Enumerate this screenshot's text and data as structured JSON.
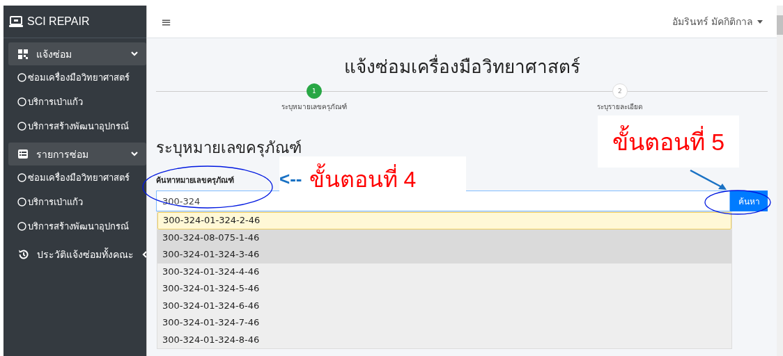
{
  "sidebar": {
    "brand": "SCI REPAIR",
    "groups": [
      {
        "label": "แจ้งซ่อม",
        "expanded": true,
        "items": [
          "ซ่อมเครื่องมือวิทยาศาสตร์",
          "บริการเป่าแก้ว",
          "บริการสร้างพัฒนาอุปกรณ์"
        ]
      },
      {
        "label": "รายการซ่อม",
        "expanded": true,
        "items": [
          "ซ่อมเครื่องมือวิทยาศาสตร์",
          "บริการเป่าแก้ว",
          "บริการสร้างพัฒนาอุปกรณ์"
        ]
      },
      {
        "label": "ประวัติแจ้งซ่อมทั้งคณะ",
        "expanded": false
      }
    ]
  },
  "header": {
    "menu_icon": "≡",
    "user": "อัมรินทร์ มัคกิติกาล"
  },
  "page_title": "แจ้งซ่อมเครื่องมือวิทยาศาสตร์",
  "steps": [
    {
      "number": "1",
      "label": "ระบุหมายเลขครุภัณฑ์",
      "active": true
    },
    {
      "number": "2",
      "label": "ระบุรายละเอียด",
      "active": false
    }
  ],
  "section_title": "ระบุหมายเลขครุภัณฑ์",
  "search": {
    "label": "ค้นหาหมายเลขครุภัณฑ์",
    "value": "300-324",
    "button": "ค้นหา"
  },
  "suggestions": [
    {
      "text": "300-324-01-324-2-46",
      "kind": "active"
    },
    {
      "text": "300-324-08-075-1-46",
      "kind": "shaded"
    },
    {
      "text": "300-324-01-324-3-46",
      "kind": "shaded"
    },
    {
      "text": "300-324-01-324-4-46",
      "kind": "plain"
    },
    {
      "text": "300-324-01-324-5-46",
      "kind": "plain"
    },
    {
      "text": "300-324-01-324-6-46",
      "kind": "plain"
    },
    {
      "text": "300-324-01-324-7-46",
      "kind": "plain"
    },
    {
      "text": "300-324-01-324-8-46",
      "kind": "plain"
    }
  ],
  "annotations": [
    {
      "arrow": "<--",
      "text": "ขั้นตอนที่ 4"
    },
    {
      "text": "ขั้นตอนที่ 5"
    }
  ]
}
